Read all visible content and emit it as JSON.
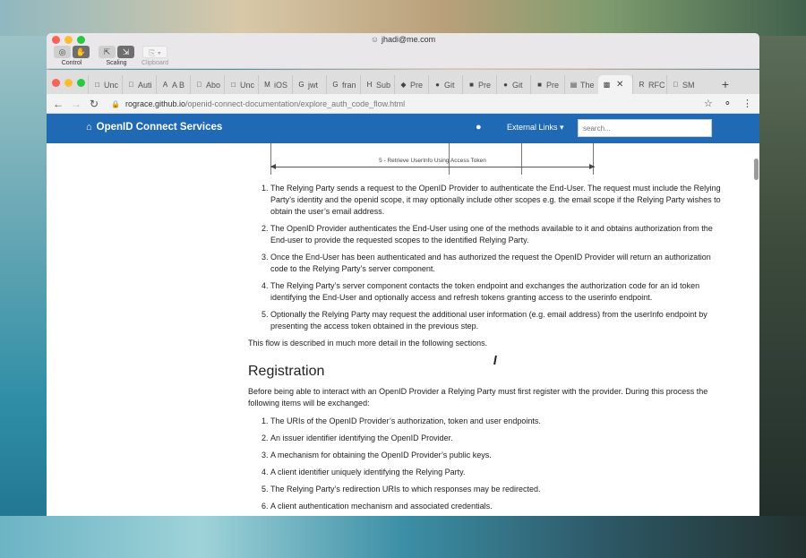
{
  "remote_desktop": {
    "title": "jhadi@me.com",
    "tools": [
      {
        "label": "Control"
      },
      {
        "label": "Scaling"
      },
      {
        "label": "Clipboard"
      }
    ]
  },
  "browser": {
    "tabs": [
      {
        "label": "Unc",
        "icon": "document-icon"
      },
      {
        "label": "Auti",
        "icon": "apple-icon"
      },
      {
        "label": "A B",
        "icon": "a-logo-icon"
      },
      {
        "label": "Abo",
        "icon": "apple-icon"
      },
      {
        "label": "Unc",
        "icon": "document-icon"
      },
      {
        "label": "iOS",
        "icon": "medium-icon"
      },
      {
        "label": "jwt",
        "icon": "google-icon"
      },
      {
        "label": "fran",
        "icon": "google-icon"
      },
      {
        "label": "Sub",
        "icon": "hacker-icon"
      },
      {
        "label": "Pre",
        "icon": "figma-icon"
      },
      {
        "label": "Git",
        "icon": "github-icon"
      },
      {
        "label": "Pre",
        "icon": "slide-icon"
      },
      {
        "label": "Git",
        "icon": "github-icon"
      },
      {
        "label": "Pre",
        "icon": "slide-icon"
      },
      {
        "label": "The",
        "icon": "ietf-icon"
      },
      {
        "label": "",
        "icon": "openid-icon",
        "active": true
      },
      {
        "label": "RFC",
        "icon": "rfc-icon"
      },
      {
        "label": "SM",
        "icon": "apple-icon"
      }
    ],
    "url": {
      "host": "rograce.github.io",
      "path": "/openid-connect-documentation/explore_auth_code_flow.html"
    }
  },
  "site": {
    "brand": "OpenID Connect Services",
    "external_links": "External Links",
    "search_placeholder": "search..."
  },
  "diagram": {
    "label": "5 - Retrieve UserInfo Using Access Token"
  },
  "content": {
    "steps": [
      "The Relying Party sends a request to the OpenID Provider to authenticate the End-User. The request must include the Relying Party’s identity and the openid scope, it may optionally include other scopes e.g. the email scope if the Relying Party wishes to obtain the user’s email address.",
      "The OpenID Provider authenticates the End-User using one of the methods available to it and obtains authorization from the End-user to provide the requested scopes to the identified Relying Party.",
      "Once the End-User has been authenticated and has authorized the request the OpenID Provider will return an authorization code to the Relying Party’s server component.",
      "The Relying Party’s server component contacts the token endpoint and exchanges the authorization code for an id token identifying the End-User and optionally access and refresh tokens granting access to the userinfo endpoint.",
      "Optionally the Relying Party may request the additional user information (e.g. email address) from the userInfo endpoint by presenting the access token obtained in the previous step."
    ],
    "flow_note": "This flow is described in much more detail in the following sections.",
    "registration_heading": "Registration",
    "registration_intro": "Before being able to interact with an OpenID Provider a Relying Party must first register with the provider. During this process the following items will be exchanged:",
    "registration_items": [
      "The URIs of the OpenID Provider’s authorization, token and user endpoints.",
      "An issuer identifier identifying the OpenID Provider.",
      "A mechanism for obtaining the OpenID Provider’s public keys.",
      "A client identifier uniquely identifying the Relying Party.",
      "The Relying Party’s redirection URIs to which responses may be redirected.",
      "A client authentication mechanism and associated credentials."
    ]
  }
}
